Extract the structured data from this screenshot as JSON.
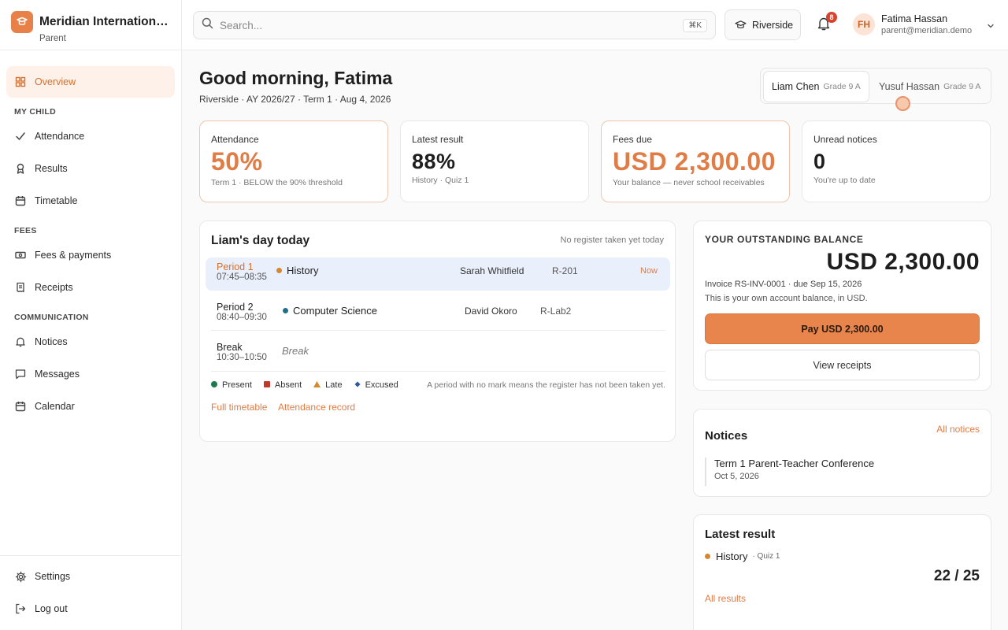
{
  "brand": {
    "name": "Meridian International School",
    "role": "Parent"
  },
  "nav": {
    "overview": "Overview",
    "section_child": "MY CHILD",
    "attendance": "Attendance",
    "results": "Results",
    "timetable": "Timetable",
    "section_fees": "FEES",
    "fees_payments": "Fees & payments",
    "receipts": "Receipts",
    "section_comm": "COMMUNICATION",
    "notices": "Notices",
    "messages": "Messages",
    "calendar": "Calendar",
    "settings": "Settings",
    "logout": "Log out"
  },
  "topbar": {
    "search_placeholder": "Search...",
    "search_shortcut": "⌘K",
    "campus": "Riverside",
    "notification_count": "8",
    "user_initials": "FH",
    "user_name": "Fatima Hassan",
    "user_email": "parent@meridian.demo"
  },
  "header": {
    "greeting": "Good morning, Fatima",
    "subline": "Riverside · AY 2026/27 · Term 1 · Aug 4, 2026"
  },
  "children": [
    {
      "name": "Liam Chen",
      "grade": "Grade 9 A"
    },
    {
      "name": "Yusuf Hassan",
      "grade": "Grade 9 A"
    }
  ],
  "stats": {
    "attendance": {
      "label": "Attendance",
      "value": "50%",
      "sub": "Term 1 · BELOW the 90% threshold"
    },
    "latest": {
      "label": "Latest result",
      "value": "88%",
      "sub": "History · Quiz 1"
    },
    "fees": {
      "label": "Fees due",
      "value": "USD 2,300.00",
      "sub": "Your balance — never school receivables"
    },
    "notices": {
      "label": "Unread notices",
      "value": "0",
      "sub": "You're up to date"
    }
  },
  "day": {
    "title": "Liam's day today",
    "note": "No register taken yet today",
    "periods": [
      {
        "name": "Period 1",
        "time": "07:45–08:35",
        "subject": "History",
        "teacher": "Sarah Whitfield",
        "room": "R-201",
        "status": "Now",
        "dot_color": "#d4892e"
      },
      {
        "name": "Period 2",
        "time": "08:40–09:30",
        "subject": "Computer Science",
        "teacher": "David Okoro",
        "room": "R-Lab2",
        "dot_color": "#1f6f8b"
      },
      {
        "name": "Break",
        "time": "10:30–10:50",
        "subject": "Break"
      }
    ],
    "legend": {
      "present": "Present",
      "absent": "Absent",
      "late": "Late",
      "excused": "Excused",
      "note": "A period with no mark means the register has not been taken yet."
    },
    "links": {
      "timetable": "Full timetable",
      "attendance": "Attendance record"
    }
  },
  "balance": {
    "label": "YOUR OUTSTANDING BALANCE",
    "amount": "USD 2,300.00",
    "invoice": "Invoice RS-INV-0001 · due Sep 15, 2026",
    "note": "This is your own account balance, in USD.",
    "pay": "Pay USD 2,300.00",
    "receipts": "View receipts"
  },
  "notices": {
    "title": "Notices",
    "link": "All notices",
    "items": [
      {
        "title": "Term 1 Parent-Teacher Conference",
        "date": "Oct 5, 2026"
      }
    ]
  },
  "result": {
    "title": "Latest result",
    "subject": "History",
    "sub": "· Quiz 1",
    "score": "22 / 25",
    "link": "All results"
  },
  "colors": {
    "accent": "#e07c45",
    "now_bg": "#eaf0fb",
    "absent": "#c0392b",
    "late": "#d4892e",
    "excused": "#2c5aa0",
    "present": "#1e7a4a"
  }
}
